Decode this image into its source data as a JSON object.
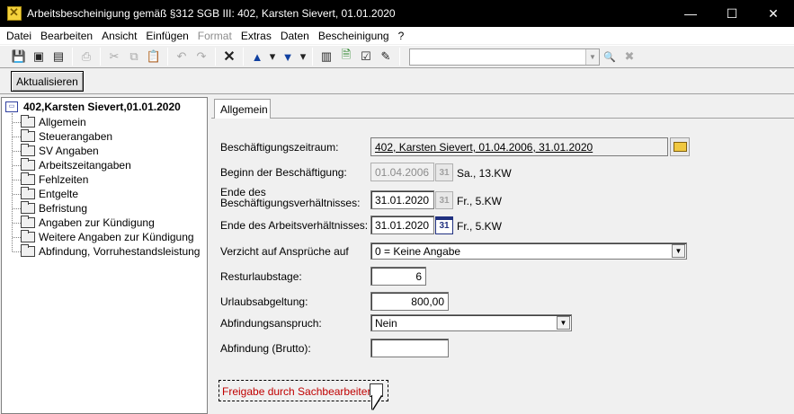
{
  "window": {
    "title": "Arbeitsbescheinigung gemäß §312 SGB III: 402, Karsten Sievert, 01.01.2020",
    "minimize": "—",
    "maximize": "☐",
    "close": "✕"
  },
  "menu": [
    {
      "label": "Datei",
      "disabled": false
    },
    {
      "label": "Bearbeiten",
      "disabled": false
    },
    {
      "label": "Ansicht",
      "disabled": false
    },
    {
      "label": "Einfügen",
      "disabled": false
    },
    {
      "label": "Format",
      "disabled": true
    },
    {
      "label": "Extras",
      "disabled": false
    },
    {
      "label": "Daten",
      "disabled": false
    },
    {
      "label": "Bescheinigung",
      "disabled": false
    },
    {
      "label": "?",
      "disabled": false
    }
  ],
  "toolbar": {
    "icons": {
      "save": "💾",
      "save_all": "▣",
      "save_copy": "▤",
      "print": "⎙",
      "cut": "✂",
      "copy": "⧉",
      "paste": "📋",
      "undo": "↶",
      "redo": "↷",
      "delete": "✕",
      "move_up": "▲",
      "move_down": "▼",
      "dropdown": "▾",
      "grid": "▥",
      "add_doc": "🗎",
      "check": "☑",
      "stamp": "✎",
      "search": "🔍",
      "clear_search": "✖"
    },
    "search_value": "",
    "search_arrow": "▼",
    "aktualisieren_label": "Aktualisieren"
  },
  "tree": {
    "root": "402,Karsten Sievert,01.01.2020",
    "root_icon": "▭",
    "items": [
      "Allgemein",
      "Steuerangaben",
      "SV Angaben",
      "Arbeitszeitangaben",
      "Fehlzeiten",
      "Entgelte",
      "Befristung",
      "Angaben zur Kündigung",
      "Weitere Angaben zur Kündigung",
      "Abfindung, Vorruhestandsleistung"
    ]
  },
  "tabs": [
    "Allgemein"
  ],
  "form": {
    "zeitraum_label": "Beschäftigungszeitraum:",
    "zeitraum_value": "402, Karsten Sievert, 01.04.2006, 31.01.2020",
    "beginn_label": "Beginn der Beschäftigung:",
    "beginn_value": "01.04.2006",
    "beginn_suffix": "Sa., 13.KW",
    "ende_bv_label_1": "Ende des",
    "ende_bv_label_2": "Beschäftigungsverhältnisses:",
    "ende_bv_value": "31.01.2020",
    "ende_bv_suffix": "Fr., 5.KW",
    "ende_av_label": "Ende des Arbeitsverhältnisses:",
    "ende_av_value": "31.01.2020",
    "ende_av_suffix": "Fr., 5.KW",
    "calendar_glyph": "31",
    "verzicht_label": "Verzicht auf Ansprüche auf",
    "verzicht_value": "0 = Keine Angabe",
    "resturlaub_label": "Resturlaubstage:",
    "resturlaub_value": "6",
    "urlaubsabgeltung_label": "Urlaubsabgeltung:",
    "urlaubsabgeltung_value": "800,00",
    "abfindungsanspruch_label": "Abfindungsanspruch:",
    "abfindungsanspruch_value": "Nein",
    "abfindung_brutto_label": "Abfindung (Brutto):",
    "abfindung_brutto_value": "",
    "freigabe_label": "Freigabe durch Sachbearbeiter:",
    "select_arrow": "▼"
  }
}
